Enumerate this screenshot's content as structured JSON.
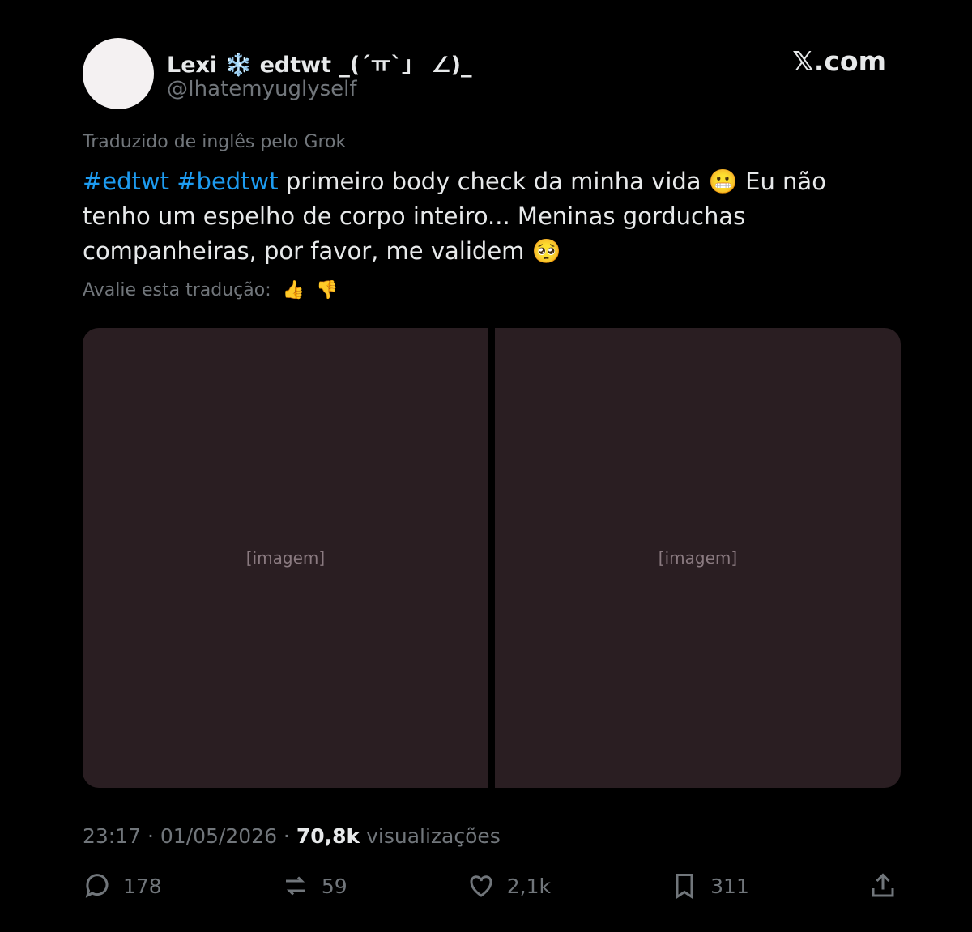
{
  "author": {
    "display_name": "Lexi ❄️ edtwt _(´ㅠ`」 ∠)_",
    "handle": "@Ihatemyuglyself"
  },
  "brand": "𝕏.com",
  "translation_note": "Traduzido de inglês pelo Grok",
  "tweet": {
    "hashtag1": "#edtwt",
    "hashtag2": "#bedtwt",
    "text": " primeiro body check da minha vida 😬 Eu não tenho um espelho de corpo inteiro... Meninas gorduchas companheiras, por favor, me validem 🥺"
  },
  "rate_translation": "Avalie esta tradução:",
  "media": {
    "left_label": "[imagem]",
    "right_label": "[imagem]"
  },
  "meta": {
    "time_date": "23:17 · 01/05/2026 · ",
    "views_count": "70,8k",
    "views_label": " visualizações"
  },
  "actions": {
    "replies": "178",
    "reposts": "59",
    "likes": "2,1k",
    "bookmarks": "311"
  }
}
